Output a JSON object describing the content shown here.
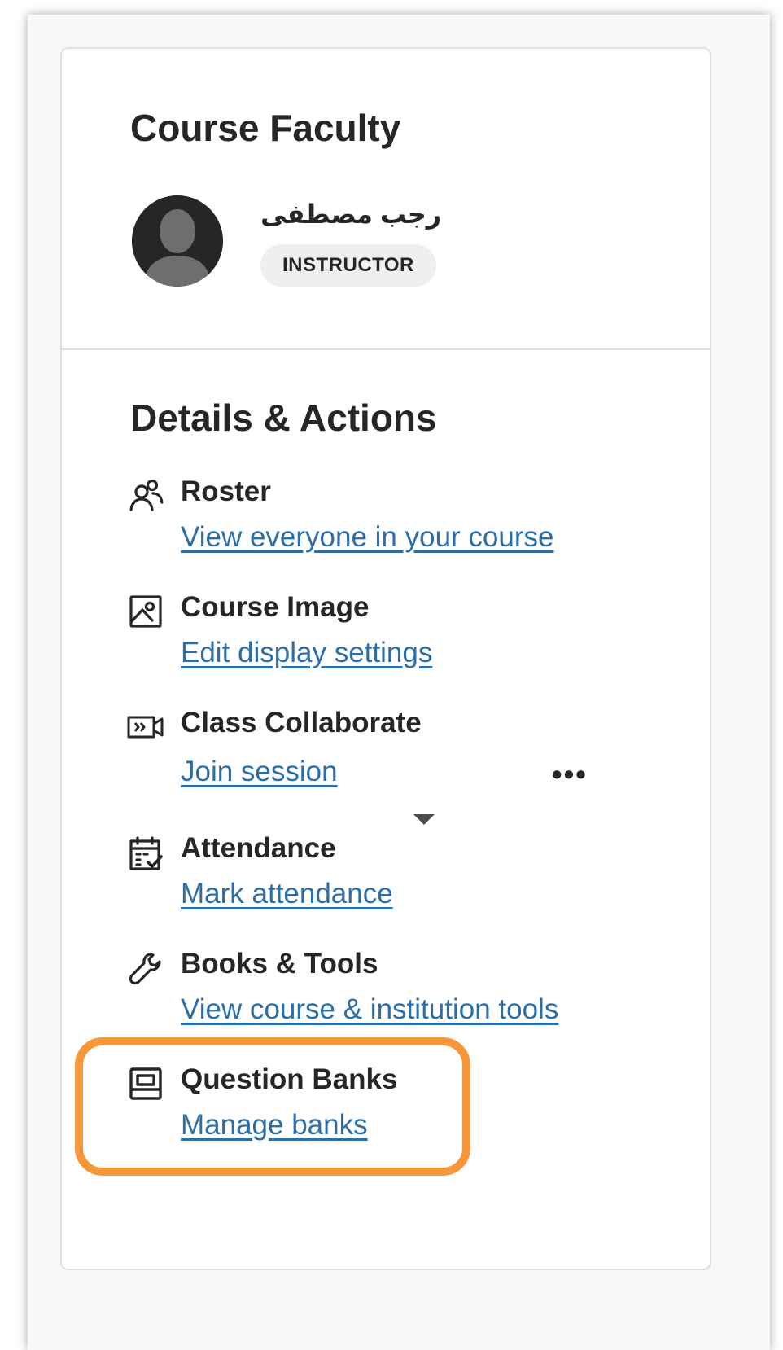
{
  "faculty": {
    "heading": "Course Faculty",
    "instructor_name": "رجب مصطفى",
    "role": "INSTRUCTOR",
    "avatar_icon": "user-silhouette-icon"
  },
  "details": {
    "heading": "Details & Actions",
    "items": [
      {
        "icon": "roster-people-icon",
        "title": "Roster",
        "link": "View everyone in your course"
      },
      {
        "icon": "image-icon",
        "title": "Course Image",
        "link": "Edit display settings"
      },
      {
        "icon": "video-collaborate-icon",
        "title": "Class Collaborate",
        "link": "Join session",
        "menu": "•••"
      },
      {
        "icon": "calendar-check-icon",
        "title": "Attendance",
        "link": "Mark attendance"
      },
      {
        "icon": "wrench-icon",
        "title": "Books & Tools",
        "link": "View course & institution tools"
      },
      {
        "icon": "question-bank-icon",
        "title": "Question Banks",
        "link": "Manage banks"
      }
    ]
  },
  "colors": {
    "link": "#2c6ea8",
    "text": "#262626",
    "highlight": "#f7973a",
    "badge_bg": "#efefef"
  }
}
